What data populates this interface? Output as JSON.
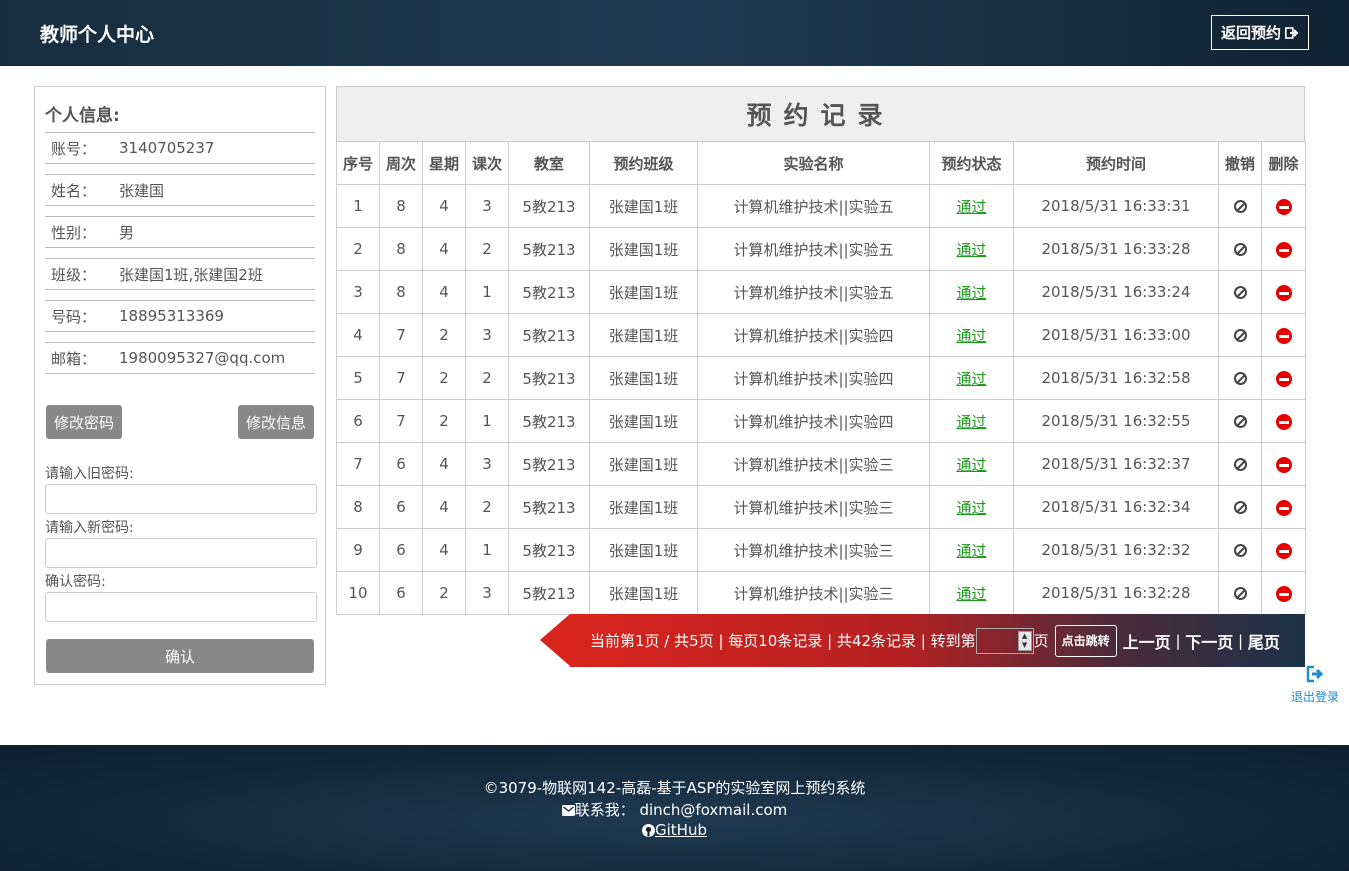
{
  "header": {
    "title": "教师个人中心",
    "back_label": "返回预约"
  },
  "profile": {
    "heading": "个人信息:",
    "fields": [
      {
        "label": "账号：",
        "value": "3140705237"
      },
      {
        "label": "姓名：",
        "value": "张建国"
      },
      {
        "label": "性别：",
        "value": "男"
      },
      {
        "label": "班级：",
        "value": "张建国1班,张建国2班"
      },
      {
        "label": "号码：",
        "value": "18895313369"
      },
      {
        "label": "邮箱：",
        "value": "1980095327@qq.com"
      }
    ],
    "change_password_label": "修改密码",
    "edit_info_label": "修改信息",
    "old_password_label": "请输入旧密码:",
    "new_password_label": "请输入新密码:",
    "confirm_password_label": "确认密码:",
    "confirm_button": "确认"
  },
  "records": {
    "caption": "预约记录",
    "columns": [
      "序号",
      "周次",
      "星期",
      "课次",
      "教室",
      "预约班级",
      "实验名称",
      "预约状态",
      "预约时间",
      "撤销",
      "删除"
    ],
    "rows": [
      [
        "1",
        "8",
        "4",
        "3",
        "5教213",
        "张建国1班",
        "计算机维护技术||实验五",
        "通过",
        "2018/5/31 16:33:31"
      ],
      [
        "2",
        "8",
        "4",
        "2",
        "5教213",
        "张建国1班",
        "计算机维护技术||实验五",
        "通过",
        "2018/5/31 16:33:28"
      ],
      [
        "3",
        "8",
        "4",
        "1",
        "5教213",
        "张建国1班",
        "计算机维护技术||实验五",
        "通过",
        "2018/5/31 16:33:24"
      ],
      [
        "4",
        "7",
        "2",
        "3",
        "5教213",
        "张建国1班",
        "计算机维护技术||实验四",
        "通过",
        "2018/5/31 16:33:00"
      ],
      [
        "5",
        "7",
        "2",
        "2",
        "5教213",
        "张建国1班",
        "计算机维护技术||实验四",
        "通过",
        "2018/5/31 16:32:58"
      ],
      [
        "6",
        "7",
        "2",
        "1",
        "5教213",
        "张建国1班",
        "计算机维护技术||实验四",
        "通过",
        "2018/5/31 16:32:55"
      ],
      [
        "7",
        "6",
        "4",
        "3",
        "5教213",
        "张建国1班",
        "计算机维护技术||实验三",
        "通过",
        "2018/5/31 16:32:37"
      ],
      [
        "8",
        "6",
        "4",
        "2",
        "5教213",
        "张建国1班",
        "计算机维护技术||实验三",
        "通过",
        "2018/5/31 16:32:34"
      ],
      [
        "9",
        "6",
        "4",
        "1",
        "5教213",
        "张建国1班",
        "计算机维护技术||实验三",
        "通过",
        "2018/5/31 16:32:32"
      ],
      [
        "10",
        "6",
        "2",
        "3",
        "5教213",
        "张建国1班",
        "计算机维护技术||实验三",
        "通过",
        "2018/5/31 16:32:28"
      ]
    ]
  },
  "pager": {
    "summary": "当前第1页 / 共5页 | 每页10条记录 | 共42条记录 | 转到第",
    "page_suffix": "页",
    "jump_button": "点击跳转",
    "prev": "上一页",
    "sep1": " | ",
    "next": "下一页",
    "sep2": " | ",
    "last": "尾页"
  },
  "logout_label": "退出登录",
  "footer": {
    "copyright": "©3079-物联网142-高磊-基于ASP的实验室网上预约系统",
    "contact": "联系我： dinch@foxmail.com",
    "github": "GitHub"
  },
  "colors": {
    "header_bg": "#1e3a52",
    "status_green": "#1a9a1a",
    "delete_red": "#e60000",
    "pager_red": "#d8241d",
    "logout_blue": "#1e8ccf"
  }
}
